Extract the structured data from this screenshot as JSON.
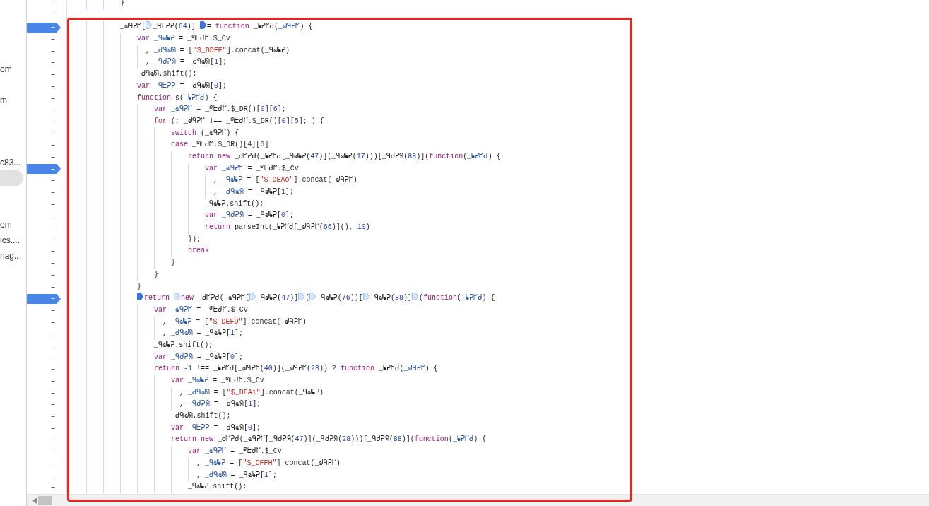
{
  "sidebar": {
    "items": [
      {
        "label": "om",
        "selected": false
      },
      {
        "selected": false
      },
      {
        "label": "m",
        "selected": false
      },
      {
        "selected": false
      },
      {
        "selected": false
      },
      {
        "selected": false
      },
      {
        "label": "c83...",
        "selected": false
      },
      {
        "selected": true
      },
      {
        "selected": false
      },
      {
        "selected": false
      },
      {
        "label": "om",
        "selected": false
      },
      {
        "label": "ics....",
        "selected": false
      },
      {
        "label": "nag...",
        "selected": false
      }
    ]
  },
  "editor": {
    "lines": [
      {
        "number": "–",
        "breakpoint": false,
        "tokens": [
          {
            "kind": "plain",
            "text": "            }"
          }
        ]
      },
      {
        "number": "–",
        "breakpoint": false
      },
      {
        "number": "–",
        "breakpoint": true,
        "tokens": [
          {
            "kind": "plain",
            "text": "            _ᖙᑫᕈᖸ["
          },
          {
            "kind": "breakpoint",
            "active": false
          },
          {
            "kind": "plain",
            "text": "_ᑫᖶᕈᕈ("
          },
          {
            "kind": "number",
            "text": "64"
          },
          {
            "kind": "plain",
            "text": ")] "
          },
          {
            "kind": "breakpoint",
            "active": true
          },
          {
            "kind": "plain",
            "text": "= "
          },
          {
            "kind": "keyword",
            "text": "function"
          },
          {
            "kind": "plain",
            "text": " _ᖲᕈᖸᑯ("
          },
          {
            "kind": "def",
            "text": "_ᖙᑫᕈᖸ"
          },
          {
            "kind": "plain",
            "text": ") {"
          }
        ]
      },
      {
        "number": "–",
        "breakpoint": false,
        "tokens": [
          {
            "kind": "keyword",
            "text": "                var"
          },
          {
            "kind": "def",
            "text": " _ᑫᖙᖲᕈ"
          },
          {
            "kind": "plain",
            "text": " = _ᖗᖶᑯᖸ.$_Cv"
          }
        ]
      },
      {
        "number": "–",
        "breakpoint": false,
        "tokens": [
          {
            "kind": "plain",
            "text": "                  , "
          },
          {
            "kind": "def",
            "text": "_ᑯᑫᖙᖆ"
          },
          {
            "kind": "plain",
            "text": " = ["
          },
          {
            "kind": "string",
            "text": "\"$_DDFE\""
          },
          {
            "kind": "plain",
            "text": "].concat(_ᑫᖙᖲᕈ)"
          }
        ]
      },
      {
        "number": "–",
        "breakpoint": false,
        "tokens": [
          {
            "kind": "plain",
            "text": "                  , "
          },
          {
            "kind": "def",
            "text": "_ᑫᑯᕈᖆ"
          },
          {
            "kind": "plain",
            "text": " = _ᑯᑫᖙᖆ["
          },
          {
            "kind": "number",
            "text": "1"
          },
          {
            "kind": "plain",
            "text": "];"
          }
        ]
      },
      {
        "number": "–",
        "breakpoint": false,
        "tokens": [
          {
            "kind": "plain",
            "text": "                _ᑯᑫᖙᖆ.shift();"
          }
        ]
      },
      {
        "number": "–",
        "breakpoint": false,
        "tokens": [
          {
            "kind": "keyword",
            "text": "                var"
          },
          {
            "kind": "def",
            "text": " _ᑫᖶᕈᕈ"
          },
          {
            "kind": "plain",
            "text": " = _ᑯᑫᖙᖆ["
          },
          {
            "kind": "number",
            "text": "0"
          },
          {
            "kind": "plain",
            "text": "];"
          }
        ]
      },
      {
        "number": "–",
        "breakpoint": false,
        "tokens": [
          {
            "kind": "keyword",
            "text": "                function"
          },
          {
            "kind": "plain",
            "text": " s("
          },
          {
            "kind": "def",
            "text": "_ᖲᕈᖸᑯ"
          },
          {
            "kind": "plain",
            "text": ") {"
          }
        ]
      },
      {
        "number": "–",
        "breakpoint": false,
        "tokens": [
          {
            "kind": "keyword",
            "text": "                    var"
          },
          {
            "kind": "def",
            "text": " _ᖙᑫᕈᖸ"
          },
          {
            "kind": "plain",
            "text": " = _ᖗᖶᑯᖸ.$_DR()["
          },
          {
            "kind": "number",
            "text": "0"
          },
          {
            "kind": "plain",
            "text": "]["
          },
          {
            "kind": "number",
            "text": "6"
          },
          {
            "kind": "plain",
            "text": "];"
          }
        ]
      },
      {
        "number": "–",
        "breakpoint": false,
        "tokens": [
          {
            "kind": "keyword",
            "text": "                    for"
          },
          {
            "kind": "plain",
            "text": " (; _ᖙᑫᕈᖸ !== _ᖗᖶᑯᖸ.$_DR()["
          },
          {
            "kind": "number",
            "text": "0"
          },
          {
            "kind": "plain",
            "text": "]["
          },
          {
            "kind": "number",
            "text": "5"
          },
          {
            "kind": "plain",
            "text": "]; ) {"
          }
        ]
      },
      {
        "number": "–",
        "breakpoint": false,
        "tokens": [
          {
            "kind": "keyword",
            "text": "                        switch"
          },
          {
            "kind": "plain",
            "text": " (_ᖙᑫᕈᖸ) {"
          }
        ]
      },
      {
        "number": "–",
        "breakpoint": false,
        "tokens": [
          {
            "kind": "keyword",
            "text": "                        case"
          },
          {
            "kind": "plain",
            "text": " _ᖗᖶᑯᖸ.$_DR()["
          },
          {
            "kind": "number",
            "text": "4"
          },
          {
            "kind": "plain",
            "text": "]["
          },
          {
            "kind": "number",
            "text": "6"
          },
          {
            "kind": "plain",
            "text": "]:"
          }
        ]
      },
      {
        "number": "–",
        "breakpoint": false,
        "tokens": [
          {
            "kind": "keyword",
            "text": "                            return"
          },
          {
            "kind": "keyword",
            "text": " new"
          },
          {
            "kind": "plain",
            "text": " _ᑯᖸᕈᑯ(_ᖲᕈᖸᑯ[_ᑫᖙᖲᕈ("
          },
          {
            "kind": "number",
            "text": "47"
          },
          {
            "kind": "plain",
            "text": ")](_ᑫᖙᖲᕈ("
          },
          {
            "kind": "number",
            "text": "17"
          },
          {
            "kind": "plain",
            "text": ")))[_ᑫᑯᕈᖆ("
          },
          {
            "kind": "number",
            "text": "88"
          },
          {
            "kind": "plain",
            "text": ")]("
          },
          {
            "kind": "keyword",
            "text": "function"
          },
          {
            "kind": "plain",
            "text": "("
          },
          {
            "kind": "def",
            "text": "_ᖲᕈᖸᑯ"
          },
          {
            "kind": "plain",
            "text": ") {"
          }
        ]
      },
      {
        "number": "–",
        "breakpoint": true,
        "tokens": [
          {
            "kind": "keyword",
            "text": "                                var"
          },
          {
            "kind": "def",
            "text": " _ᖙᑫᕈᖸ"
          },
          {
            "kind": "plain",
            "text": " = _ᖗᖶᑯᖸ.$_Cv"
          }
        ]
      },
      {
        "number": "–",
        "breakpoint": false,
        "tokens": [
          {
            "kind": "plain",
            "text": "                                  , "
          },
          {
            "kind": "def",
            "text": "_ᑫᖙᖲᕈ"
          },
          {
            "kind": "plain",
            "text": " = ["
          },
          {
            "kind": "string",
            "text": "\"$_DEAo\""
          },
          {
            "kind": "plain",
            "text": "].concat(_ᖙᑫᕈᖸ)"
          }
        ]
      },
      {
        "number": "–",
        "breakpoint": false,
        "tokens": [
          {
            "kind": "plain",
            "text": "                                  , "
          },
          {
            "kind": "def",
            "text": "_ᑯᑫᖙᖆ"
          },
          {
            "kind": "plain",
            "text": " = _ᑫᖙᖲᕈ["
          },
          {
            "kind": "number",
            "text": "1"
          },
          {
            "kind": "plain",
            "text": "];"
          }
        ]
      },
      {
        "number": "–",
        "breakpoint": false,
        "tokens": [
          {
            "kind": "plain",
            "text": "                                _ᑫᖙᖲᕈ.shift();"
          }
        ]
      },
      {
        "number": "–",
        "breakpoint": false,
        "tokens": [
          {
            "kind": "keyword",
            "text": "                                var"
          },
          {
            "kind": "def",
            "text": " _ᑫᑯᕈᖆ"
          },
          {
            "kind": "plain",
            "text": " = _ᑫᖙᖲᕈ["
          },
          {
            "kind": "number",
            "text": "0"
          },
          {
            "kind": "plain",
            "text": "];"
          }
        ]
      },
      {
        "number": "–",
        "breakpoint": false,
        "tokens": [
          {
            "kind": "keyword",
            "text": "                                return"
          },
          {
            "kind": "plain",
            "text": " parseInt(_ᖲᕈᖸᑯ[_ᖙᑫᕈᖸ("
          },
          {
            "kind": "number",
            "text": "66"
          },
          {
            "kind": "plain",
            "text": ")](), "
          },
          {
            "kind": "number",
            "text": "10"
          },
          {
            "kind": "plain",
            "text": ")"
          }
        ]
      },
      {
        "number": "–",
        "breakpoint": false,
        "tokens": [
          {
            "kind": "plain",
            "text": "                            });"
          }
        ]
      },
      {
        "number": "–",
        "breakpoint": false,
        "tokens": [
          {
            "kind": "keyword",
            "text": "                            break"
          }
        ]
      },
      {
        "number": "–",
        "breakpoint": false,
        "tokens": [
          {
            "kind": "plain",
            "text": "                        }"
          }
        ]
      },
      {
        "number": "–",
        "breakpoint": false,
        "tokens": [
          {
            "kind": "plain",
            "text": "                    }"
          }
        ]
      },
      {
        "number": "–",
        "breakpoint": false,
        "tokens": [
          {
            "kind": "plain",
            "text": "                }"
          }
        ]
      },
      {
        "number": "–",
        "breakpoint": true,
        "tokens": [
          {
            "kind": "breakpoint",
            "active": true
          },
          {
            "kind": "keyword",
            "text": "return "
          },
          {
            "kind": "breakpoint",
            "active": false
          },
          {
            "kind": "keyword",
            "text": "new"
          },
          {
            "kind": "plain",
            "text": " _ᑯᖸᕈᑯ(_ᖙᑫᕈᖸ["
          },
          {
            "kind": "breakpoint",
            "active": false
          },
          {
            "kind": "plain",
            "text": "_ᑫᖙᖲᕈ("
          },
          {
            "kind": "number",
            "text": "47"
          },
          {
            "kind": "plain",
            "text": ")]"
          },
          {
            "kind": "breakpoint",
            "active": false
          },
          {
            "kind": "plain",
            "text": "("
          },
          {
            "kind": "breakpoint",
            "active": false
          },
          {
            "kind": "plain",
            "text": "_ᑫᖙᖲᕈ("
          },
          {
            "kind": "number",
            "text": "76"
          },
          {
            "kind": "plain",
            "text": "))["
          },
          {
            "kind": "breakpoint",
            "active": false
          },
          {
            "kind": "plain",
            "text": "_ᑫᖙᖲᕈ("
          },
          {
            "kind": "number",
            "text": "88"
          },
          {
            "kind": "plain",
            "text": ")]"
          },
          {
            "kind": "breakpoint",
            "active": false
          },
          {
            "kind": "plain",
            "text": "("
          },
          {
            "kind": "keyword",
            "text": "function"
          },
          {
            "kind": "plain",
            "text": "("
          },
          {
            "kind": "def",
            "text": "_ᖲᕈᖸᑯ"
          },
          {
            "kind": "plain",
            "text": ") {"
          }
        ]
      },
      {
        "number": "–",
        "breakpoint": false,
        "tokens": [
          {
            "kind": "keyword",
            "text": "                    var"
          },
          {
            "kind": "def",
            "text": " _ᖙᑫᕈᖸ"
          },
          {
            "kind": "plain",
            "text": " = _ᖗᖶᑯᖸ.$_Cv"
          }
        ]
      },
      {
        "number": "–",
        "breakpoint": false,
        "tokens": [
          {
            "kind": "plain",
            "text": "                      , "
          },
          {
            "kind": "def",
            "text": "_ᑫᖙᖲᕈ"
          },
          {
            "kind": "plain",
            "text": " = ["
          },
          {
            "kind": "string",
            "text": "\"$_DEFD\""
          },
          {
            "kind": "plain",
            "text": "].concat(_ᖙᑫᕈᖸ)"
          }
        ]
      },
      {
        "number": "–",
        "breakpoint": false,
        "tokens": [
          {
            "kind": "plain",
            "text": "                      , "
          },
          {
            "kind": "def",
            "text": "_ᑯᑫᖙᖆ"
          },
          {
            "kind": "plain",
            "text": " = _ᑫᖙᖲᕈ["
          },
          {
            "kind": "number",
            "text": "1"
          },
          {
            "kind": "plain",
            "text": "];"
          }
        ]
      },
      {
        "number": "–",
        "breakpoint": false,
        "tokens": [
          {
            "kind": "plain",
            "text": "                    _ᑫᖙᖲᕈ.shift();"
          }
        ]
      },
      {
        "number": "–",
        "breakpoint": false,
        "tokens": [
          {
            "kind": "keyword",
            "text": "                    var"
          },
          {
            "kind": "def",
            "text": " _ᑫᑯᕈᖆ"
          },
          {
            "kind": "plain",
            "text": " = _ᑫᖙᖲᕈ["
          },
          {
            "kind": "number",
            "text": "0"
          },
          {
            "kind": "plain",
            "text": "];"
          }
        ]
      },
      {
        "number": "–",
        "breakpoint": false,
        "tokens": [
          {
            "kind": "keyword",
            "text": "                    return"
          },
          {
            "kind": "number",
            "text": " -1"
          },
          {
            "kind": "plain",
            "text": " !== _ᖲᕈᖸᑯ[_ᖙᑫᕈᖸ("
          },
          {
            "kind": "number",
            "text": "40"
          },
          {
            "kind": "plain",
            "text": ")](_ᖙᑫᕈᖸ("
          },
          {
            "kind": "number",
            "text": "28"
          },
          {
            "kind": "plain",
            "text": ")) ? "
          },
          {
            "kind": "keyword",
            "text": "function"
          },
          {
            "kind": "plain",
            "text": " _ᖲᕈᖸᑯ("
          },
          {
            "kind": "def",
            "text": "_ᖙᑫᕈᖸ"
          },
          {
            "kind": "plain",
            "text": ") {"
          }
        ]
      },
      {
        "number": "–",
        "breakpoint": false,
        "tokens": [
          {
            "kind": "keyword",
            "text": "                        var"
          },
          {
            "kind": "def",
            "text": " _ᑫᖙᖲᕈ"
          },
          {
            "kind": "plain",
            "text": " = _ᖗᖶᑯᖸ.$_Cv"
          }
        ]
      },
      {
        "number": "–",
        "breakpoint": false,
        "tokens": [
          {
            "kind": "plain",
            "text": "                          , "
          },
          {
            "kind": "def",
            "text": "_ᑯᑫᖙᖆ"
          },
          {
            "kind": "plain",
            "text": " = ["
          },
          {
            "kind": "string",
            "text": "\"$_DFAi\""
          },
          {
            "kind": "plain",
            "text": "].concat(_ᑫᖙᖲᕈ)"
          }
        ]
      },
      {
        "number": "–",
        "breakpoint": false,
        "tokens": [
          {
            "kind": "plain",
            "text": "                          , "
          },
          {
            "kind": "def",
            "text": "_ᑫᑯᕈᖆ"
          },
          {
            "kind": "plain",
            "text": " = _ᑯᑫᖙᖆ["
          },
          {
            "kind": "number",
            "text": "1"
          },
          {
            "kind": "plain",
            "text": "];"
          }
        ]
      },
      {
        "number": "–",
        "breakpoint": false,
        "tokens": [
          {
            "kind": "plain",
            "text": "                        _ᑯᑫᖙᖆ.shift();"
          }
        ]
      },
      {
        "number": "–",
        "breakpoint": false,
        "tokens": [
          {
            "kind": "keyword",
            "text": "                        var"
          },
          {
            "kind": "def",
            "text": " _ᑫᖶᕈᕈ"
          },
          {
            "kind": "plain",
            "text": " = _ᑯᑫᖙᖆ["
          },
          {
            "kind": "number",
            "text": "0"
          },
          {
            "kind": "plain",
            "text": "];"
          }
        ]
      },
      {
        "number": "–",
        "breakpoint": false,
        "tokens": [
          {
            "kind": "keyword",
            "text": "                        return"
          },
          {
            "kind": "keyword",
            "text": " new"
          },
          {
            "kind": "plain",
            "text": " _ᑯᖸᕈᑯ(_ᖙᑫᕈᖸ[_ᑫᑯᕈᖆ("
          },
          {
            "kind": "number",
            "text": "47"
          },
          {
            "kind": "plain",
            "text": ")](_ᑫᑯᕈᖆ("
          },
          {
            "kind": "number",
            "text": "28"
          },
          {
            "kind": "plain",
            "text": ")))[_ᑫᑯᕈᖆ("
          },
          {
            "kind": "number",
            "text": "88"
          },
          {
            "kind": "plain",
            "text": ")]("
          },
          {
            "kind": "keyword",
            "text": "function"
          },
          {
            "kind": "plain",
            "text": "("
          },
          {
            "kind": "def",
            "text": "_ᖲᕈᖸᑯ"
          },
          {
            "kind": "plain",
            "text": ") {"
          }
        ]
      },
      {
        "number": "–",
        "breakpoint": false,
        "tokens": [
          {
            "kind": "keyword",
            "text": "                            var"
          },
          {
            "kind": "def",
            "text": " _ᖙᑫᕈᖸ"
          },
          {
            "kind": "plain",
            "text": " = _ᖗᖶᑯᖸ.$_Cv"
          }
        ]
      },
      {
        "number": "–",
        "breakpoint": false,
        "tokens": [
          {
            "kind": "plain",
            "text": "                              , "
          },
          {
            "kind": "def",
            "text": "_ᑫᖙᖲᕈ"
          },
          {
            "kind": "plain",
            "text": " = ["
          },
          {
            "kind": "string",
            "text": "\"$_DFFH\""
          },
          {
            "kind": "plain",
            "text": "].concat(_ᖙᑫᕈᖸ)"
          }
        ]
      },
      {
        "number": "–",
        "breakpoint": false,
        "tokens": [
          {
            "kind": "plain",
            "text": "                              , "
          },
          {
            "kind": "def",
            "text": "_ᑯᑫᖙᖆ"
          },
          {
            "kind": "plain",
            "text": " = _ᑫᖙᖲᕈ["
          },
          {
            "kind": "number",
            "text": "1"
          },
          {
            "kind": "plain",
            "text": "];"
          }
        ]
      },
      {
        "number": "–",
        "breakpoint": false,
        "tokens": [
          {
            "kind": "plain",
            "text": "                            _ᑫᖙᖲᕈ.shift();"
          }
        ]
      }
    ]
  }
}
